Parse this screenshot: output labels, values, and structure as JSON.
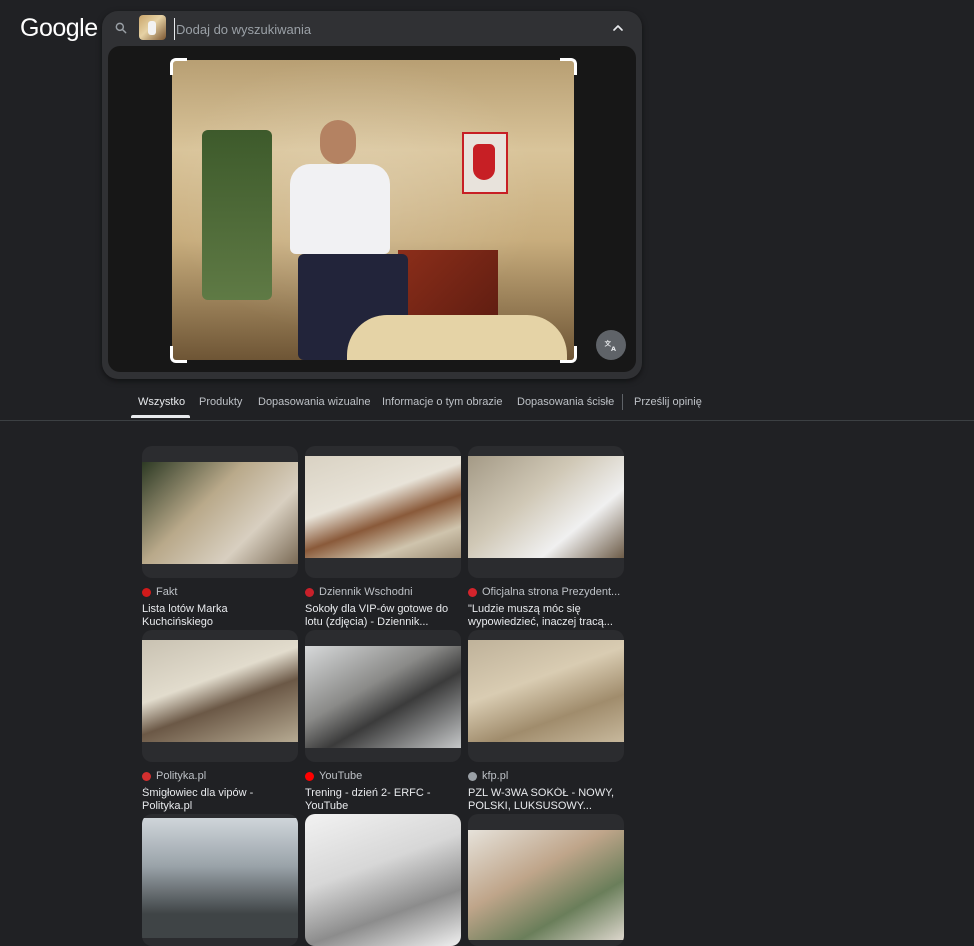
{
  "logo": "Google",
  "search": {
    "placeholder": "Dodaj do wyszukiwania",
    "value": ""
  },
  "tabs": [
    {
      "label": "Wszystko",
      "active": true
    },
    {
      "label": "Produkty"
    },
    {
      "label": "Dopasowania wizualne"
    },
    {
      "label": "Informacje o tym obrazie"
    },
    {
      "label": "Dopasowania ścisłe"
    },
    {
      "label": "Prześlij opinię"
    }
  ],
  "results": [
    {
      "source": "Fakt",
      "title": "Lista lotów Marka Kuchcińskiego",
      "favicon_color": "#d11a1a"
    },
    {
      "source": "Dziennik Wschodni",
      "title": "Sokoły dla VIP-ów gotowe do lotu (zdjęcia) - Dziennik...",
      "favicon_color": "#c8202a"
    },
    {
      "source": "Oficjalna strona Prezydent...",
      "title": "\"Ludzie muszą móc się wypowiedzieć, inaczej tracą...",
      "favicon_color": "#d4242c"
    },
    {
      "source": "Polityka.pl",
      "title": "Śmigłowiec dla vipów - Polityka.pl",
      "favicon_color": "#d32f2f"
    },
    {
      "source": "YouTube",
      "title": "Trening - dzień 2- ERFC - YouTube",
      "favicon_color": "#ff0000"
    },
    {
      "source": "kfp.pl",
      "title": "PZL W-3WA SOKÓŁ - NOWY, POLSKI, LUKSUSOWY...",
      "favicon_color": "#9aa0a6"
    },
    {
      "source": "",
      "title": "",
      "favicon_color": "#9aa0a6"
    },
    {
      "source": "",
      "title": "",
      "favicon_color": "#9aa0a6"
    },
    {
      "source": "",
      "title": "",
      "favicon_color": "#9aa0a6"
    }
  ],
  "icons": {
    "search": "search-icon",
    "chevron": "chevron-up-icon",
    "translate": "translate-icon"
  }
}
